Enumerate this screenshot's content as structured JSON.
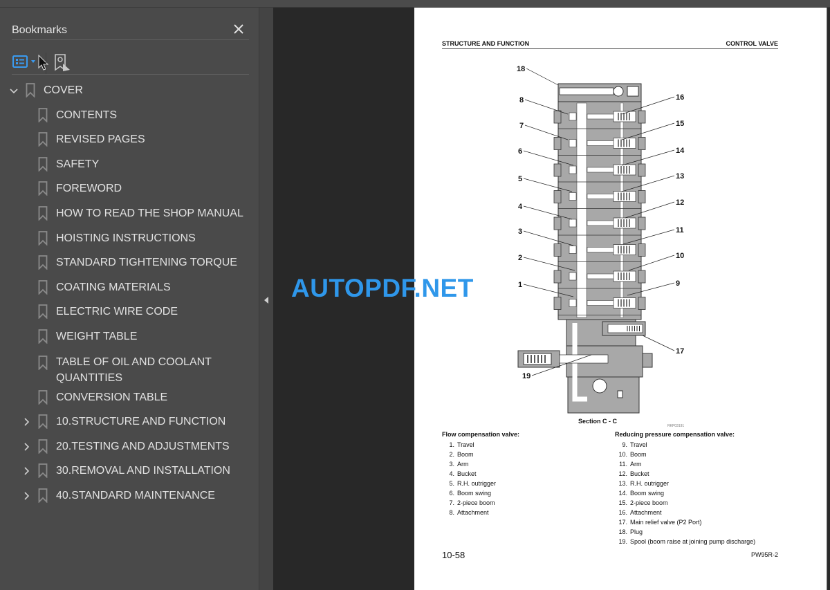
{
  "sidebar": {
    "title": "Bookmarks",
    "close_icon": "close-icon",
    "tools": {
      "options_icon": "bookmark-options-icon",
      "find_current_icon": "find-current-bookmark-icon"
    },
    "bookmarks": [
      {
        "label": "COVER",
        "level": 0,
        "expander": "expanded"
      },
      {
        "label": "CONTENTS",
        "level": 1,
        "expander": "none"
      },
      {
        "label": "REVISED PAGES",
        "level": 1,
        "expander": "none"
      },
      {
        "label": "SAFETY",
        "level": 1,
        "expander": "none"
      },
      {
        "label": "FOREWORD",
        "level": 1,
        "expander": "none"
      },
      {
        "label": "HOW TO READ THE SHOP MANUAL",
        "level": 1,
        "expander": "none"
      },
      {
        "label": "HOISTING INSTRUCTIONS",
        "level": 1,
        "expander": "none"
      },
      {
        "label": "STANDARD TIGHTENING TORQUE",
        "level": 1,
        "expander": "none"
      },
      {
        "label": "COATING MATERIALS",
        "level": 1,
        "expander": "none"
      },
      {
        "label": "ELECTRIC WIRE CODE",
        "level": 1,
        "expander": "none"
      },
      {
        "label": "WEIGHT TABLE",
        "level": 1,
        "expander": "none"
      },
      {
        "label": "TABLE OF OIL AND COOLANT",
        "label2": "QUANTITIES",
        "level": 1,
        "expander": "none"
      },
      {
        "label": "CONVERSION TABLE",
        "level": 1,
        "expander": "none"
      },
      {
        "label": "10.STRUCTURE AND FUNCTION",
        "level": 1,
        "expander": "collapsed"
      },
      {
        "label": "20.TESTING AND ADJUSTMENTS",
        "level": 1,
        "expander": "collapsed"
      },
      {
        "label": "30.REMOVAL AND INSTALLATION",
        "level": 1,
        "expander": "collapsed"
      },
      {
        "label": "40.STANDARD MAINTENANCE",
        "level": 1,
        "expander": "collapsed"
      }
    ]
  },
  "watermark": "AUTOPDF.NET",
  "page": {
    "header_left": "STRUCTURE AND FUNCTION",
    "header_right": "CONTROL VALVE",
    "figure": {
      "callouts_left": [
        "18",
        "8",
        "7",
        "6",
        "5",
        "4",
        "3",
        "2",
        "1",
        "19"
      ],
      "callouts_right": [
        "16",
        "15",
        "14",
        "13",
        "12",
        "11",
        "10",
        "9",
        "17"
      ],
      "section_label": "Section C - C",
      "figure_id": "RKP03191"
    },
    "legend_left": {
      "title": "Flow compensation valve:",
      "items": [
        {
          "num": "1.",
          "text": "Travel"
        },
        {
          "num": "2.",
          "text": "Boom"
        },
        {
          "num": "3.",
          "text": "Arm"
        },
        {
          "num": "4.",
          "text": "Bucket"
        },
        {
          "num": "5.",
          "text": "R.H. outrigger"
        },
        {
          "num": "6.",
          "text": "Boom swing"
        },
        {
          "num": "7.",
          "text": "2-piece boom"
        },
        {
          "num": "8.",
          "text": "Attachment"
        }
      ]
    },
    "legend_right": {
      "title": "Reducing pressure compensation valve:",
      "items": [
        {
          "num": "9.",
          "text": "Travel"
        },
        {
          "num": "10.",
          "text": "Boom"
        },
        {
          "num": "11.",
          "text": "Arm"
        },
        {
          "num": "12.",
          "text": "Bucket"
        },
        {
          "num": "13.",
          "text": "R.H. outrigger"
        },
        {
          "num": "14.",
          "text": "Boom swing"
        },
        {
          "num": "15.",
          "text": "2-piece boom"
        },
        {
          "num": "16.",
          "text": "Attachment"
        },
        {
          "num": "17.",
          "text": "Main relief valve (P2 Port)"
        },
        {
          "num": "18.",
          "text": "Plug"
        },
        {
          "num": "19.",
          "text": "Spool (boom raise at joining pump discharge)"
        }
      ]
    },
    "footer_left": "10-58",
    "footer_right": "PW95R-2"
  },
  "colors": {
    "accent": "#3a9bf0",
    "watermark": "#2f97ea",
    "sidebar_bg": "#4a4a4a",
    "viewer_bg": "#282828"
  }
}
